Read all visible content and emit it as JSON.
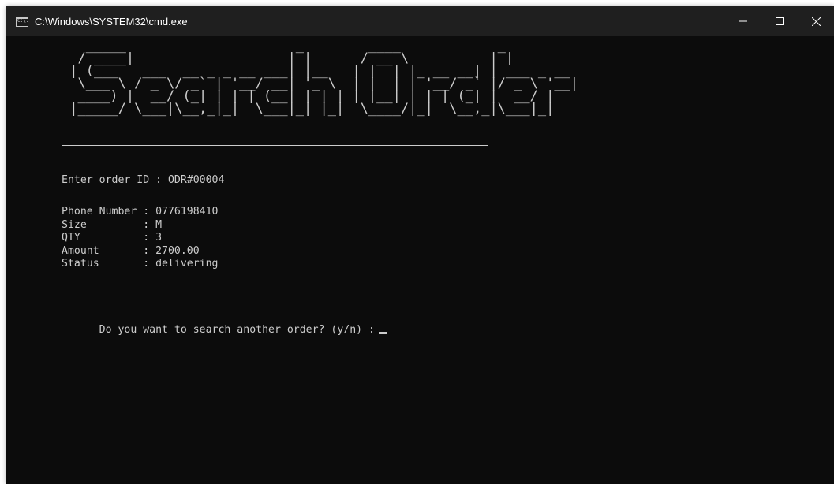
{
  "window": {
    "title": "C:\\Windows\\SYSTEM32\\cmd.exe",
    "icon_text": "C:\\."
  },
  "console": {
    "banner": "   _____                     _        ____            _\n  / ____|                   | |      / __ \\          | |\n | (___   ___  __ _ _ __ ___| |__   | |  | |_ __ __| | ___ _ __\n  \\___ \\ / _ \\/ _` | '__/ __| '_ \\  | |  | | '__/ _` |/ _ \\ '__|\n  ____) |  __/ (_| | | | (__| | | | | |__| | | | (_| |  __/ |\n |_____/ \\___|\\__,_|_|  \\___|_| |_|  \\____/|_|  \\__,_|\\___|_|",
    "prompt_order_id": "Enter order ID : ODR#00004",
    "fields": [
      {
        "text": "Phone Number : 0776198410"
      },
      {
        "text": "Size         : M"
      },
      {
        "text": "QTY          : 3"
      },
      {
        "text": "Amount       : 2700.00"
      },
      {
        "text": "Status       : delivering"
      }
    ],
    "prompt_again": "Do you want to search another order? (y/n) :"
  },
  "colors": {
    "console_bg": "#0c0c0c",
    "console_fg": "#cccccc",
    "titlebar_bg": "#1f1f1f"
  }
}
